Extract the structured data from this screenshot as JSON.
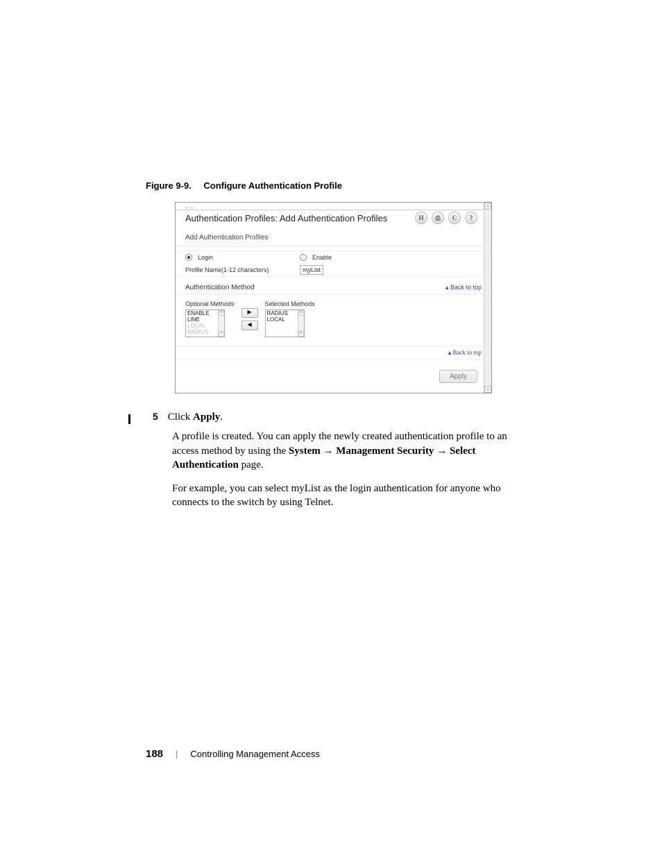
{
  "figure": {
    "label": "Figure 9-9.",
    "title": "Configure Authentication Profile"
  },
  "screenshot": {
    "crumbs_partial": "……",
    "page_title": "Authentication Profiles: Add Authentication Profiles",
    "icons": [
      "H",
      "⎙",
      "C",
      "?"
    ],
    "subheader": "Add Authentication Profiles",
    "login_label": "Login",
    "enable_label": "Enable",
    "profile_name_label": "Profile Name(1-12 characters)",
    "profile_name_value": "myList",
    "auth_method_label": "Authentication Method",
    "back_to_top": "Back to top",
    "optional_label": "Optional Methods",
    "selected_label": "Selected Methods",
    "optional_items": [
      "ENABLE",
      "LINE",
      "LOCAL",
      "RADIUS"
    ],
    "selected_items": [
      "RADIUS",
      "LOCAL"
    ],
    "apply_label": "Apply"
  },
  "step": {
    "num": "5",
    "text_prefix": "Click ",
    "text_bold": "Apply",
    "text_suffix": "."
  },
  "para1_a": "A profile is created. You can apply the newly created authentication profile to an access method by using the ",
  "para1_b": "System",
  "arrow": " → ",
  "para1_c": "Management Security",
  "para1_d": "Select Authentication",
  "para1_e": " page.",
  "para2": "For example, you can select myList as the login authentication for anyone who connects to the switch by using Telnet.",
  "footer": {
    "page": "188",
    "section": "Controlling Management Access"
  }
}
